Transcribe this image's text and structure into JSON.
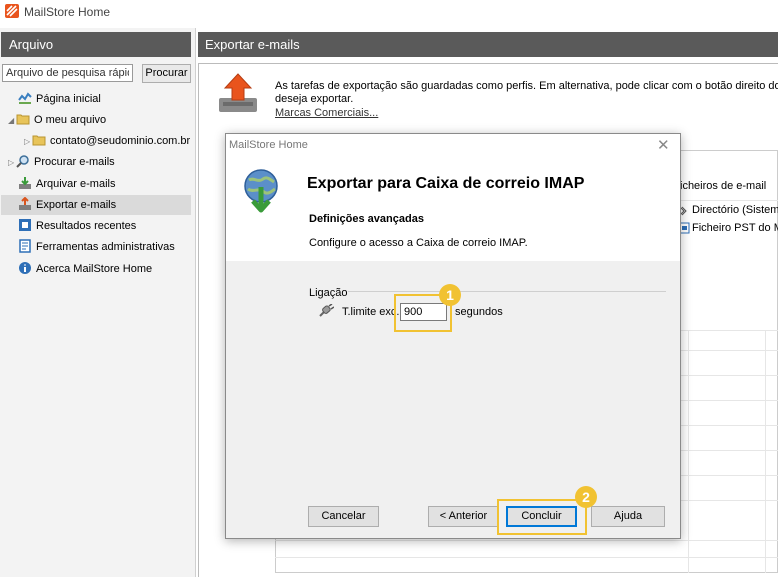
{
  "app": {
    "title": "MailStore Home"
  },
  "sidebar": {
    "header": "Arquivo",
    "search": {
      "placeholder": "Arquivo de pesquisa rápida",
      "button": "Procurar"
    },
    "items": [
      {
        "label": "Página inicial",
        "icon": "home-chart-icon"
      },
      {
        "label": "O meu arquivo",
        "icon": "folder-icon"
      },
      {
        "label": "contato@seudominio.com.br",
        "icon": "folder-icon"
      },
      {
        "label": "Procurar e-mails",
        "icon": "magnifier-icon"
      },
      {
        "label": "Arquivar e-mails",
        "icon": "archive-icon"
      },
      {
        "label": "Exportar e-mails",
        "icon": "export-icon"
      },
      {
        "label": "Resultados recentes",
        "icon": "results-icon"
      },
      {
        "label": "Ferramentas administrativas",
        "icon": "tools-icon"
      },
      {
        "label": "Acerca MailStore Home",
        "icon": "info-icon"
      }
    ]
  },
  "main": {
    "header": "Exportar e-mails",
    "intro_line1": "As tarefas de exportação são guardadas como perfis. Em alternativa, pode clicar com o botão direito do rato",
    "intro_line2": "deseja exportar.",
    "link": "Marcas Comerciais...",
    "list_header": "icheiros de e-mail",
    "list_items": [
      "Directório (Sistema",
      "Ficheiro PST do Mi"
    ]
  },
  "dialog": {
    "window_title": "MailStore Home",
    "heading": "Exportar para Caixa de correio IMAP",
    "section_title": "Definições avançadas",
    "section_desc": "Configure o acesso a Caixa de correio IMAP.",
    "group_label": "Ligação",
    "timeout_label": "T.limite exc.:",
    "timeout_value": "900",
    "timeout_unit": "segundos",
    "buttons": {
      "cancel": "Cancelar",
      "back": "< Anterior",
      "finish": "Concluir",
      "help": "Ajuda"
    }
  },
  "callouts": {
    "one": "1",
    "two": "2"
  },
  "colors": {
    "header_bg": "#5a5a5a",
    "callout": "#f1c232",
    "primary_border": "#0078d7",
    "logo": "#e9541d"
  }
}
